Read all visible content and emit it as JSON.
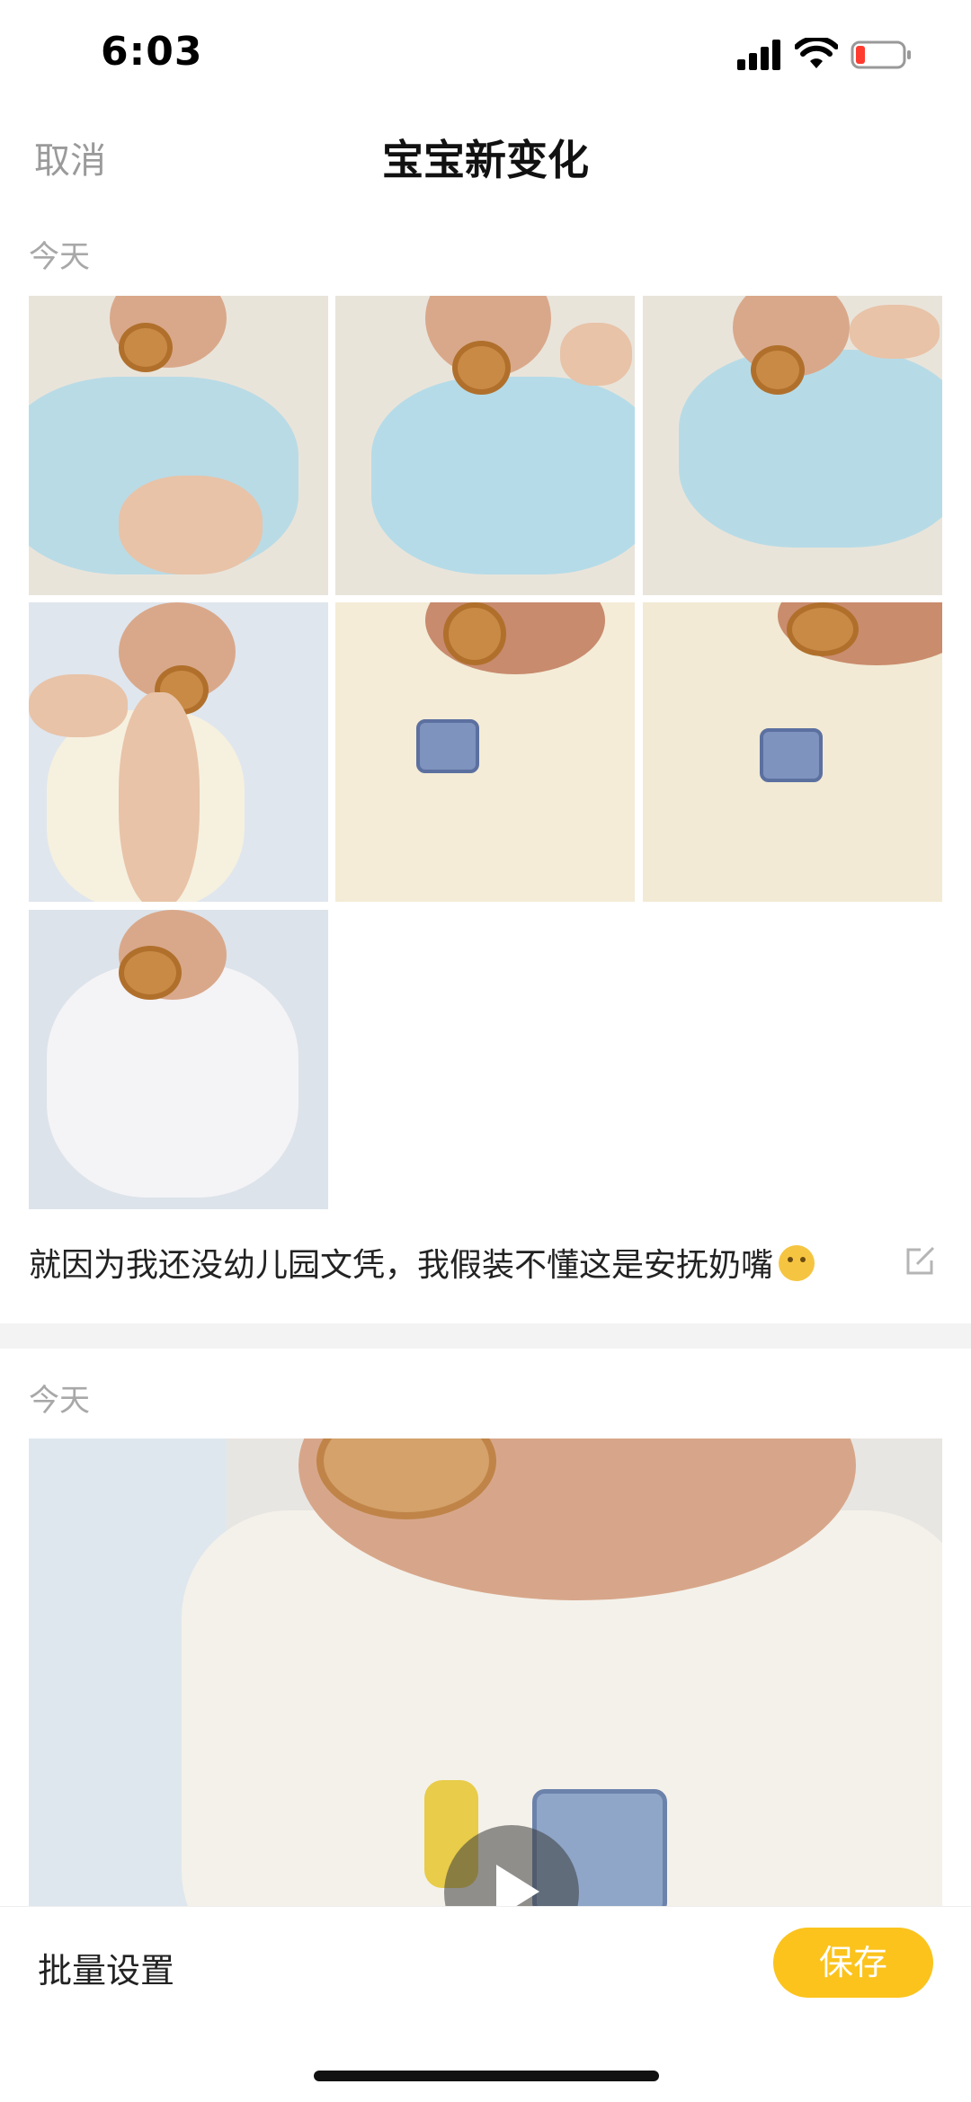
{
  "status_bar": {
    "time": "6:03"
  },
  "nav": {
    "cancel_label": "取消",
    "title": "宝宝新变化"
  },
  "sections": [
    {
      "date": "今天",
      "caption": "就因为我还没幼儿园文凭，我假装不懂这是安抚奶嘴",
      "photo_count": 7
    },
    {
      "date": "今天",
      "has_video": true
    }
  ],
  "bottom_bar": {
    "batch_label": "批量设置",
    "save_label": "保存"
  },
  "colors": {
    "accent": "#fbc31c",
    "muted_text": "#a8a8a8",
    "divider": "#f3f3f3"
  }
}
